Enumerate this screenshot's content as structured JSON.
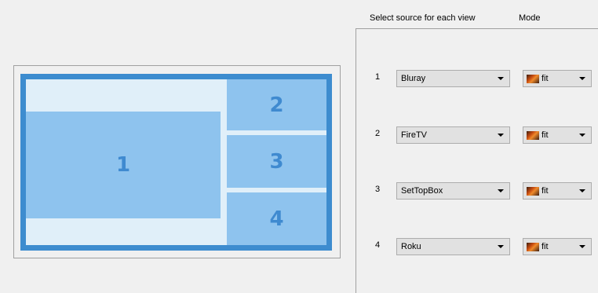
{
  "header": {
    "source_label": "Select source for each view",
    "mode_label": "Mode"
  },
  "preview": {
    "views": [
      {
        "id": "1"
      },
      {
        "id": "2"
      },
      {
        "id": "3"
      },
      {
        "id": "4"
      }
    ]
  },
  "rows": [
    {
      "number": "1",
      "source": "Bluray",
      "mode": "fit",
      "mode_icon": "fit-image-icon"
    },
    {
      "number": "2",
      "source": "FireTV",
      "mode": "fit",
      "mode_icon": "fit-image-icon"
    },
    {
      "number": "3",
      "source": "SetTopBox",
      "mode": "fit",
      "mode_icon": "fit-image-icon"
    },
    {
      "number": "4",
      "source": "Roku",
      "mode": "fit",
      "mode_icon": "fit-image-icon"
    }
  ],
  "colors": {
    "frame": "#3d8ccf",
    "view_fill": "#8ec3ee",
    "view_text": "#3f8ad0",
    "background": "#e0eff9"
  }
}
